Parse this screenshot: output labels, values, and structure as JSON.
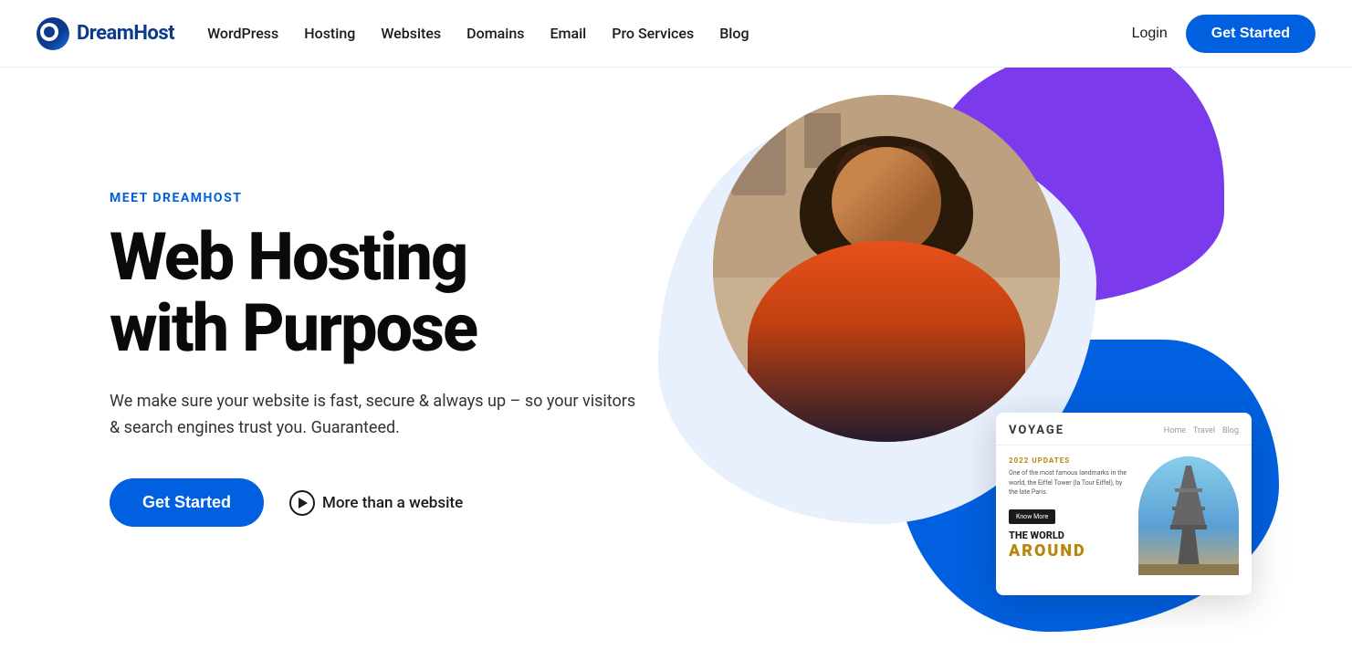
{
  "logo": {
    "text_dream": "Dream",
    "text_host": "Host",
    "full": "DreamHost"
  },
  "navbar": {
    "links": [
      {
        "id": "wordpress",
        "label": "WordPress"
      },
      {
        "id": "hosting",
        "label": "Hosting"
      },
      {
        "id": "websites",
        "label": "Websites"
      },
      {
        "id": "domains",
        "label": "Domains"
      },
      {
        "id": "email",
        "label": "Email"
      },
      {
        "id": "pro-services",
        "label": "Pro Services"
      },
      {
        "id": "blog",
        "label": "Blog"
      }
    ],
    "login_label": "Login",
    "get_started_label": "Get Started"
  },
  "hero": {
    "meet_label": "MEET DREAMHOST",
    "title_line1": "Web Hosting",
    "title_line2": "with Purpose",
    "description": "We make sure your website is fast, secure & always up – so your visitors & search engines trust you. Guaranteed.",
    "get_started_label": "Get Started",
    "more_link_label": "More than a website"
  },
  "card": {
    "title": "VOYAGE",
    "nav_items": [
      "Home",
      "Travel",
      "Blog"
    ],
    "update_label": "2022 UPDATES",
    "update_text": "One of the most famous landmarks in the world, the Eiffel Tower (la Tour Eiffel), by the late Paris.",
    "cta_label": "Know More",
    "big_text_line1": "THE WORLD",
    "big_text_line2": "AROUND"
  },
  "colors": {
    "brand_blue": "#0060df",
    "brand_dark": "#0a0a0a",
    "brand_purple": "#7c3aed",
    "navbar_border": "#eee"
  }
}
